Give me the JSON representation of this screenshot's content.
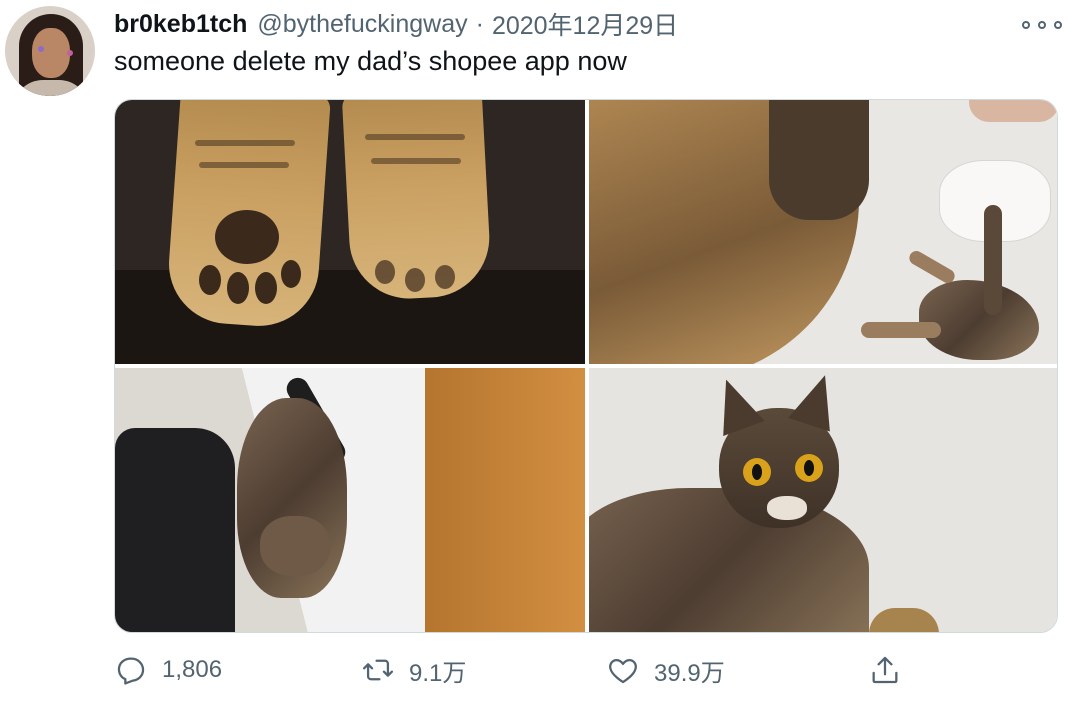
{
  "tweet": {
    "display_name": "br0keb1tch",
    "handle": "@bythefuckingway",
    "separator": "·",
    "date": "2020年12月29日",
    "text": "someone delete my dad’s shopee app now"
  },
  "media": {
    "photos": [
      {
        "subject": "cat-paw-socks"
      },
      {
        "subject": "cat-sock-and-cat-on-floor"
      },
      {
        "subject": "cat-under-cabinet"
      },
      {
        "subject": "cat-looking-at-camera"
      }
    ]
  },
  "actions": {
    "reply": {
      "icon": "reply-icon",
      "count": "1,806"
    },
    "retweet": {
      "icon": "retweet-icon",
      "count": "9.1万"
    },
    "like": {
      "icon": "heart-icon",
      "count": "39.9万"
    },
    "share": {
      "icon": "share-icon"
    }
  },
  "colors": {
    "text_primary": "#0f1419",
    "text_secondary": "#536471",
    "border": "#cfd9de"
  }
}
